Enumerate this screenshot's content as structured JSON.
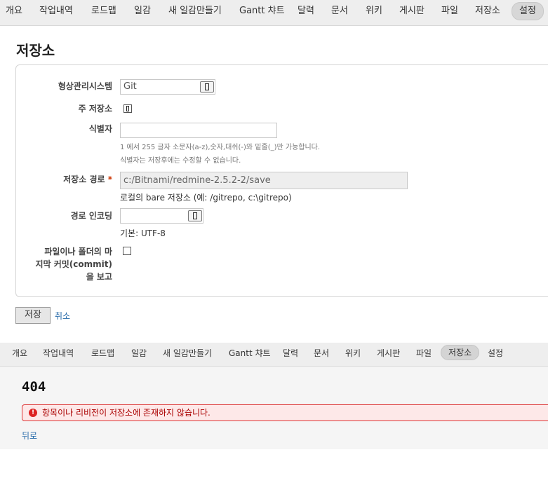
{
  "top_menu": {
    "items": [
      "개요",
      "작업내역",
      "로드맵",
      "일감",
      "새 일감만들기",
      "Gantt 챠트",
      "달력",
      "문서",
      "위키",
      "게시판",
      "파일",
      "저장소",
      "설정"
    ],
    "selected": "설정"
  },
  "page": {
    "title": "저장소"
  },
  "form": {
    "scm": {
      "label": "형상관리시스템",
      "value": "Git"
    },
    "main_repo": {
      "label": "주 저장소",
      "checked": true
    },
    "identifier": {
      "label": "식별자",
      "value": "",
      "hint1": "1 에서 255 글자 소문자(a-z),숫자,대쉬(-)와 밑줄(_)만 가능합니다.",
      "hint2": "식별자는 저장후에는 수정할 수 없습니다."
    },
    "path": {
      "label": "저장소 경로",
      "required_mark": "*",
      "value": "c:/Bitnami/redmine-2.5.2-2/save",
      "hint": "로컬의 bare 저장소 (예: /gitrepo, c:\\gitrepo)"
    },
    "encoding": {
      "label": "경로 인코딩",
      "value": "",
      "hint": "기본: UTF-8"
    },
    "report_last_commit": {
      "label_lines": [
        "파일이나 폴더의 마",
        "지막 커밋(commit)",
        "을 보고"
      ],
      "checked": false
    }
  },
  "actions": {
    "save": "저장",
    "cancel": "취소"
  },
  "panel2": {
    "menu": {
      "items": [
        "개요",
        "작업내역",
        "로드맵",
        "일감",
        "새 일감만들기",
        "Gantt 챠트",
        "달력",
        "문서",
        "위키",
        "게시판",
        "파일",
        "저장소",
        "설정"
      ],
      "selected": "저장소"
    },
    "title": "404",
    "error": "항목이나 리비전이 저장소에 존재하지 않습니다.",
    "back": "뒤로"
  }
}
